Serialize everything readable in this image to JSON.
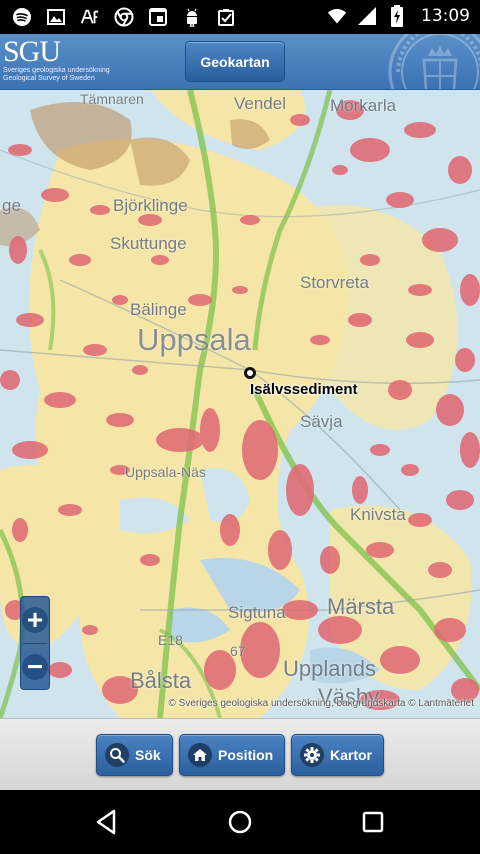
{
  "status_bar": {
    "time": "13:09",
    "left_icons": [
      "spotify-icon",
      "image-icon",
      "ae-app-icon",
      "chrome-icon",
      "screen-icon",
      "android-icon",
      "checklist-icon"
    ],
    "right_icons": [
      "wifi-icon",
      "cell-signal-icon",
      "battery-charging-icon"
    ]
  },
  "header": {
    "logo_text": "SGU",
    "logo_subtitle_1": "Sveriges geologiska undersökning",
    "logo_subtitle_2": "Geological Survey of Sweden",
    "title_button": "Geokartan"
  },
  "map": {
    "places": [
      {
        "name": "Tämnaren",
        "size": "small"
      },
      {
        "name": "Vendel",
        "size": "normal"
      },
      {
        "name": "Morkarla",
        "size": "normal"
      },
      {
        "name": "Björklinge",
        "size": "normal"
      },
      {
        "name": "Skuttunge",
        "size": "normal"
      },
      {
        "name": "Storvreta",
        "size": "normal"
      },
      {
        "name": "Bälinge",
        "size": "normal"
      },
      {
        "name": "Uppsala",
        "size": "big"
      },
      {
        "name": "Sävja",
        "size": "normal"
      },
      {
        "name": "Uppsala-Näs",
        "size": "small"
      },
      {
        "name": "Knivsta",
        "size": "normal"
      },
      {
        "name": "Sigtuna",
        "size": "normal"
      },
      {
        "name": "Märsta",
        "size": "mid"
      },
      {
        "name": "Bålsta",
        "size": "mid"
      },
      {
        "name": "Upplands",
        "size": "mid"
      },
      {
        "name": "Väsby",
        "size": "mid"
      },
      {
        "name": "E18",
        "size": "small"
      },
      {
        "name": "67",
        "size": "small"
      },
      {
        "name": "ge",
        "size": "normal"
      }
    ],
    "marker_label": "Isälvssediment",
    "zoom_in": "+",
    "zoom_out": "−",
    "attribution": "© Sveriges geologiska undersökning, bakgrundskarta © Lantmäteriet"
  },
  "toolbar": {
    "search_label": "Sök",
    "position_label": "Position",
    "maps_label": "Kartor"
  },
  "colors": {
    "header": "#3b73b3",
    "map_red": "#e06a74",
    "map_yellow": "#f5e6a8",
    "map_water": "#cfe4ec",
    "map_road": "#7cc14a",
    "map_brown": "#b98a5a",
    "button": "#2b5f9e"
  }
}
